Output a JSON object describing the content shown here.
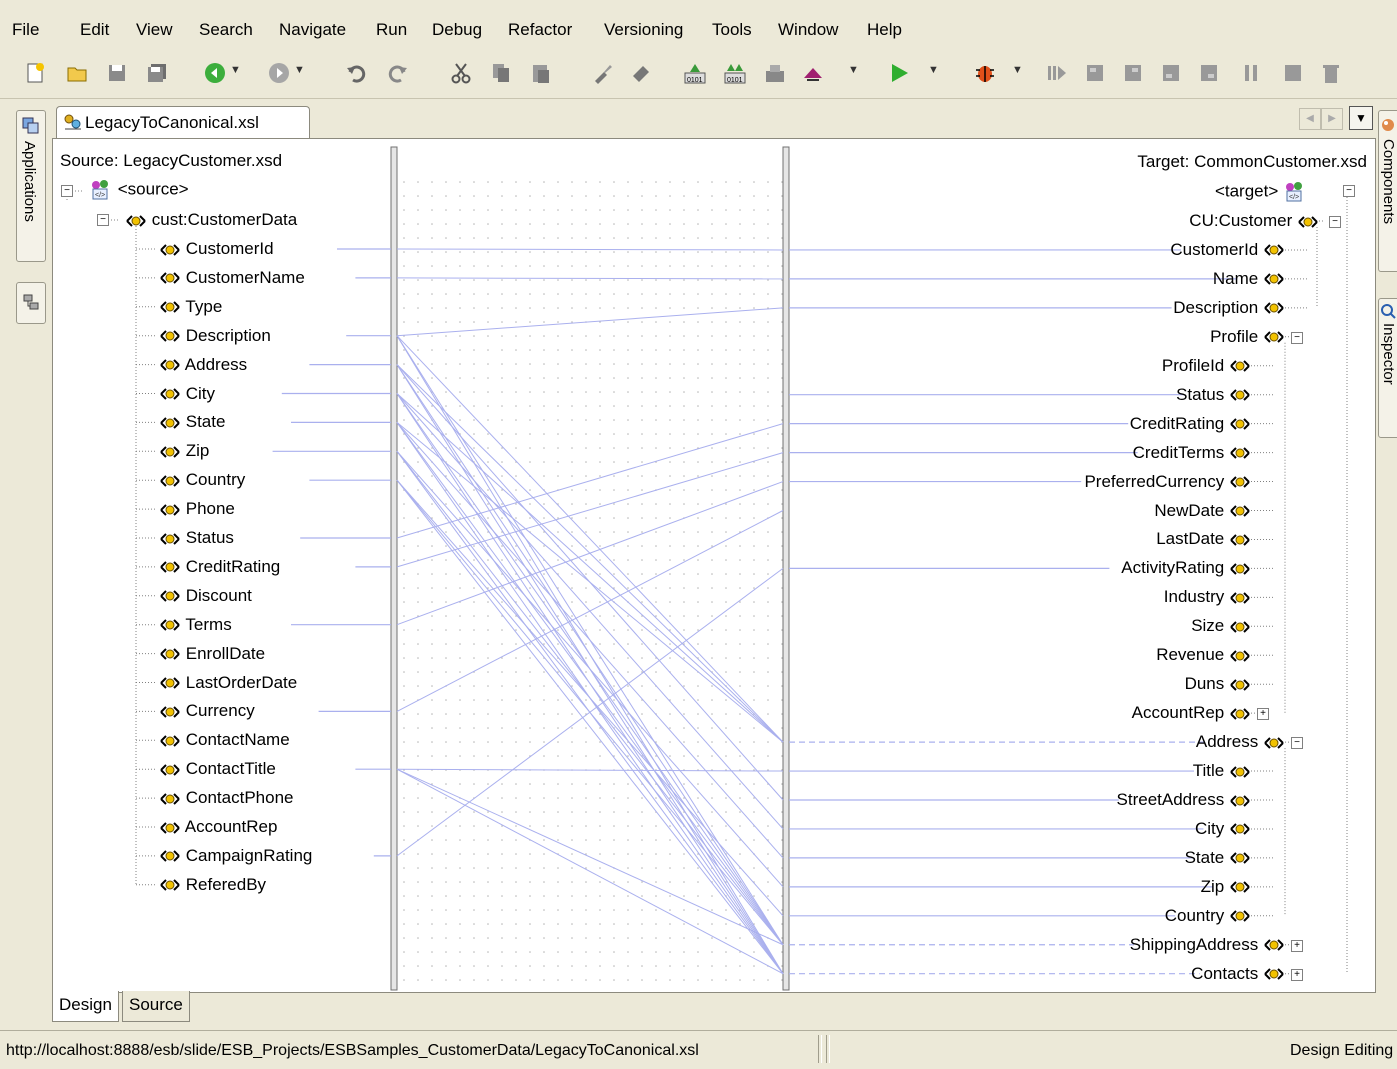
{
  "menu": [
    "File",
    "Edit",
    "View",
    "Search",
    "Navigate",
    "Run",
    "Debug",
    "Refactor",
    "Versioning",
    "Tools",
    "Window",
    "Help"
  ],
  "toolbar_icons": [
    "new-icon",
    "open-icon",
    "save-icon",
    "save-all-icon",
    "back-icon",
    "forward-icon",
    "undo-icon",
    "redo-icon",
    "cut-icon",
    "copy-icon",
    "paste-icon",
    "brush-icon",
    "find-icon",
    "make-icon",
    "rebuild-icon",
    "build-icon",
    "deploy-icon",
    "run-icon",
    "debug-icon",
    "step-icon",
    "step-over-icon",
    "step-into-icon",
    "step-out-icon",
    "pause-icon",
    "terminate-icon",
    "trash-icon"
  ],
  "left_dock": {
    "applications": "Applications"
  },
  "right_dock": {
    "components": "Components",
    "inspector": "Inspector"
  },
  "editor_tab": "LegacyToCanonical.xsl",
  "source": {
    "header": "Source: LegacyCustomer.xsd",
    "root": "<source>",
    "element": "cust:CustomerData",
    "fields": [
      "CustomerId",
      "CustomerName",
      "Type",
      "Description",
      "Address",
      "City",
      "State",
      "Zip",
      "Country",
      "Phone",
      "Status",
      "CreditRating",
      "Discount",
      "Terms",
      "EnrollDate",
      "LastOrderDate",
      "Currency",
      "ContactName",
      "ContactTitle",
      "ContactPhone",
      "AccountRep",
      "CampaignRating",
      "ReferedBy"
    ]
  },
  "target": {
    "header": "Target: CommonCustomer.xsd",
    "root": "<target>",
    "element": "CU:Customer",
    "fields": [
      "CustomerId",
      "Name",
      "Description"
    ],
    "profile": "Profile",
    "profile_fields": [
      "ProfileId",
      "Status",
      "CreditRating",
      "CreditTerms",
      "PreferredCurrency",
      "NewDate",
      "LastDate",
      "ActivityRating",
      "Industry",
      "Size",
      "Revenue",
      "Duns",
      "AccountRep"
    ],
    "address": "Address",
    "address_fields": [
      "Title",
      "StreetAddress",
      "City",
      "State",
      "Zip",
      "Country"
    ],
    "tail_fields": [
      "ShippingAddress",
      "Contacts"
    ]
  },
  "bottom_tabs": [
    "Design",
    "Source"
  ],
  "status": {
    "url": "http://localhost:8888/esb/slide/ESB_Projects/ESBSamples_CustomerData/LegacyToCanonical.xsl",
    "mode": "Design Editing"
  },
  "colors": {
    "background": "#ECE9D8",
    "link_line": "#AAB0EE",
    "tree_dotted": "#808080"
  }
}
